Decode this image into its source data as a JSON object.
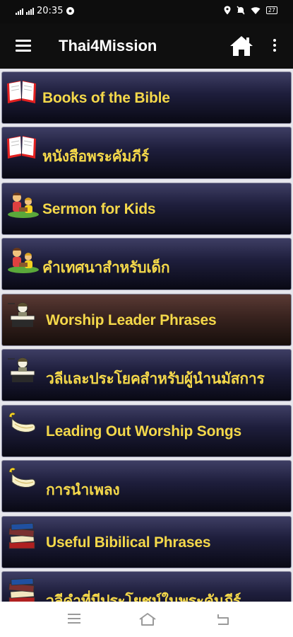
{
  "status_bar": {
    "time": "20:35",
    "battery": "27"
  },
  "app_bar": {
    "title": "Thai4Mission"
  },
  "colors": {
    "label": "#f4d84a",
    "item_bg_dark": "#0b0b18",
    "item_bg_light": "#3e3e64",
    "selected_bg": "#5a3a34",
    "app_bar": "#0f0f0f"
  },
  "items": [
    {
      "label": "Books of the Bible",
      "icon": "bible-icon"
    },
    {
      "label": "หนังสือพระคัมภีร์",
      "icon": "bible-icon"
    },
    {
      "label": "Sermon for Kids",
      "icon": "kids-icon"
    },
    {
      "label": "คำเทศนาสำหรับเด็ก",
      "icon": "kids-icon"
    },
    {
      "label": "Worship Leader Phrases",
      "icon": "leader-icon",
      "selected": true
    },
    {
      "label": "วลีและประโยคสำหรับผู้นำนมัสการ",
      "icon": "leader-icon"
    },
    {
      "label": "Leading Out Worship Songs",
      "icon": "horn-icon"
    },
    {
      "label": "การนำเพลง",
      "icon": "horn-icon"
    },
    {
      "label": "Useful Bibilical Phrases",
      "icon": "books-icon"
    },
    {
      "label": "วลีคำที่มีประโยชน์ในพระคัมภีร์",
      "icon": "books-icon"
    }
  ]
}
